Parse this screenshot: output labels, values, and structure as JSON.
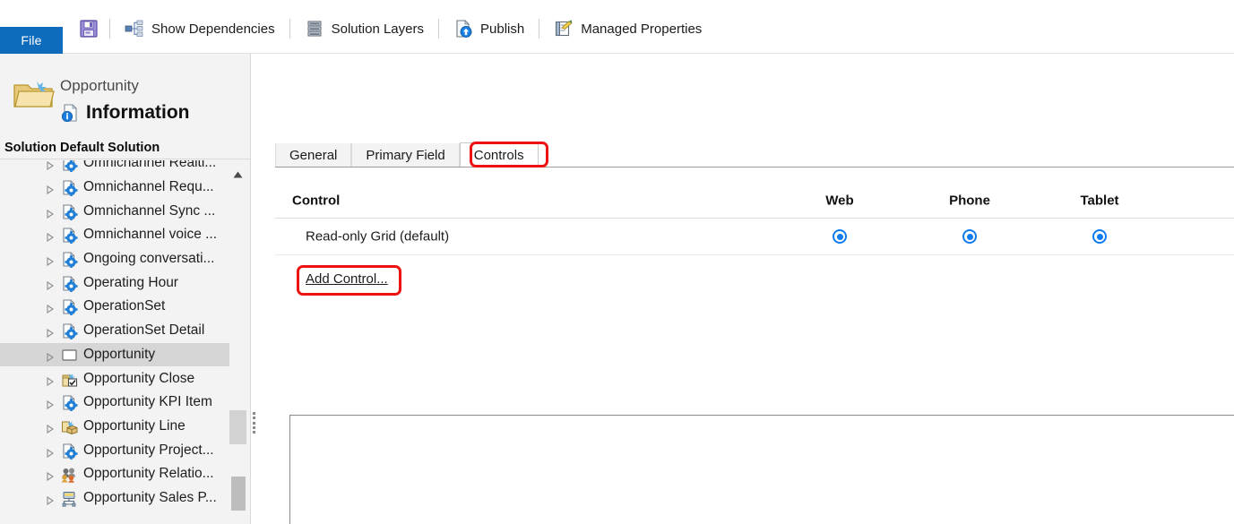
{
  "ribbon": {
    "file_tab_label": "File",
    "save_icon": "save-floppy-icon",
    "items": [
      {
        "label": "Show Dependencies",
        "icon": "show-dependencies-icon"
      },
      {
        "label": "Solution Layers",
        "icon": "solution-layers-icon"
      },
      {
        "label": "Publish",
        "icon": "publish-icon"
      },
      {
        "label": "Managed Properties",
        "icon": "managed-properties-icon"
      }
    ]
  },
  "left_panel": {
    "entity_name": "Opportunity",
    "page_title": "Information",
    "folder_icon": "folder-icon",
    "info_icon": "information-page-icon",
    "solution_bar": "Solution Default Solution",
    "tree": [
      {
        "label": "Omnichannel Realti...",
        "icon": "entity-gear-icon",
        "selected": false
      },
      {
        "label": "Omnichannel Requ...",
        "icon": "entity-gear-icon",
        "selected": false
      },
      {
        "label": "Omnichannel Sync ...",
        "icon": "entity-gear-icon",
        "selected": false
      },
      {
        "label": "Omnichannel voice ...",
        "icon": "entity-gear-icon",
        "selected": false
      },
      {
        "label": "Ongoing conversati...",
        "icon": "entity-gear-icon",
        "selected": false
      },
      {
        "label": "Operating Hour",
        "icon": "entity-gear-icon",
        "selected": false
      },
      {
        "label": "OperationSet",
        "icon": "entity-gear-icon",
        "selected": false
      },
      {
        "label": "OperationSet Detail",
        "icon": "entity-gear-icon",
        "selected": false
      },
      {
        "label": "Opportunity",
        "icon": "entity-plain-icon",
        "selected": true
      },
      {
        "label": "Opportunity Close",
        "icon": "entity-check-icon",
        "selected": false
      },
      {
        "label": "Opportunity KPI Item",
        "icon": "entity-gear-icon",
        "selected": false
      },
      {
        "label": "Opportunity Line",
        "icon": "entity-box-icon",
        "selected": false
      },
      {
        "label": "Opportunity Project...",
        "icon": "entity-gear-icon",
        "selected": false
      },
      {
        "label": "Opportunity Relatio...",
        "icon": "entity-people-icon",
        "selected": false
      },
      {
        "label": "Opportunity Sales P...",
        "icon": "entity-process-icon",
        "selected": false
      }
    ],
    "scrollbar": {
      "up_arrow": "scroll-up-arrow-icon"
    }
  },
  "main": {
    "tabs": [
      {
        "label": "General",
        "active": false
      },
      {
        "label": "Primary Field",
        "active": false
      },
      {
        "label": "Controls",
        "active": true
      }
    ],
    "grid": {
      "headers": {
        "control": "Control",
        "web": "Web",
        "phone": "Phone",
        "tablet": "Tablet"
      },
      "rows": [
        {
          "control": "Read-only Grid (default)",
          "web_selected": true,
          "phone_selected": true,
          "tablet_selected": true
        }
      ]
    },
    "add_control_label": "Add Control..."
  },
  "annotations": {
    "accent_color": "#ee1111",
    "targets": [
      "Controls",
      "Add Control..."
    ]
  },
  "colors": {
    "file_tab_blue": "#0f6cbd",
    "radio_blue": "#0f7bf0",
    "panel_gray": "#f3f3f3",
    "selected_row": "#d6d6d6"
  }
}
